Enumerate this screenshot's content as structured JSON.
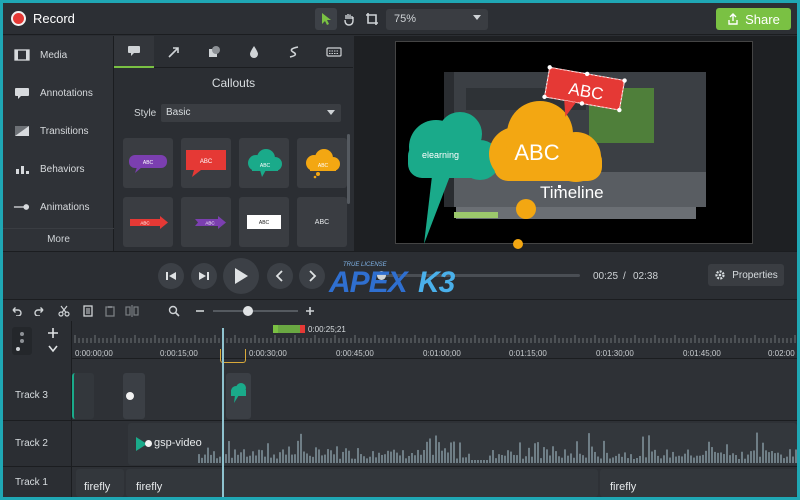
{
  "app": {
    "record_label": "Record",
    "zoom_value": "75%",
    "share_label": "Share"
  },
  "tools": [
    "pointer-icon",
    "hand-icon",
    "crop-icon"
  ],
  "sidebar": {
    "items": [
      {
        "label": "Media",
        "icon": "media-icon"
      },
      {
        "label": "Annotations",
        "icon": "annotations-icon"
      },
      {
        "label": "Transitions",
        "icon": "transitions-icon"
      },
      {
        "label": "Behaviors",
        "icon": "behaviors-icon"
      },
      {
        "label": "Animations",
        "icon": "animations-icon"
      }
    ],
    "more_label": "More"
  },
  "panel": {
    "title": "Callouts",
    "style_label": "Style",
    "style_value": "Basic",
    "tabs": [
      "callout-tab-icon",
      "arrow-tab-icon",
      "shape-tab-icon",
      "blur-tab-icon",
      "sketch-tab-icon",
      "keystroke-tab-icon"
    ],
    "thumbs": [
      {
        "text": "ABC",
        "color": "#7b3fb0",
        "shape": "speech"
      },
      {
        "text": "ABC",
        "color": "#e53935",
        "shape": "box"
      },
      {
        "text": "ABC",
        "color": "#1aaa8a",
        "shape": "cloud"
      },
      {
        "text": "ABC",
        "color": "#f3a712",
        "shape": "cloud"
      },
      {
        "text": "ABC",
        "color": "#e53935",
        "shape": "arrow"
      },
      {
        "text": "ABC",
        "color": "#7b3fb0",
        "shape": "arrow"
      },
      {
        "text": "ABC",
        "color": "#ffffff",
        "shape": "rect"
      },
      {
        "text": "ABC",
        "color": "#3a3d42",
        "shape": "plain"
      }
    ]
  },
  "canvas": {
    "cloud_green_text": "elearning",
    "cloud_orange_text": "ABC",
    "sign_text": "ABC",
    "title_text": "Timeline"
  },
  "playback": {
    "current_time": "00:25",
    "separator": "/",
    "total_time": "02:38",
    "progress": 0.0,
    "properties_label": "Properties",
    "watermark_small": "TRUE LICENSE",
    "watermark_a": "APEX",
    "watermark_b": "K3"
  },
  "timeline": {
    "playhead_time": "0:00:25;21",
    "ruler_labels": [
      "0:00:00;00",
      "0:00:15;00",
      "0:00:30;00",
      "0:00:45;00",
      "0:01:00;00",
      "0:01:15;00",
      "0:01:30;00",
      "0:01:45;00",
      "0:02:00"
    ],
    "tracks": [
      {
        "name": "Track 3"
      },
      {
        "name": "Track 2",
        "clip_label": "gsp-video"
      },
      {
        "name": "Track 1",
        "clip_labels": [
          "firefly",
          "firefly",
          "firefly"
        ]
      }
    ]
  },
  "colors": {
    "accent_green": "#7ac143",
    "record_red": "#e53935",
    "frame_teal": "#1fa7b4"
  }
}
